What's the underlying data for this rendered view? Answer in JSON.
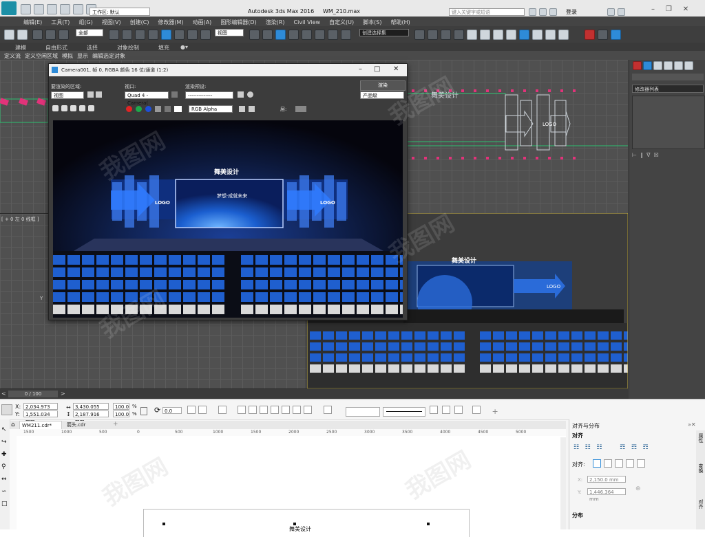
{
  "max": {
    "app_title": "Autodesk 3ds Max 2016",
    "file_name": "WM_210.max",
    "workspace_label": "工作区: 默认",
    "search_placeholder": "键入关键字或短语",
    "login_label": "登录",
    "menu": [
      "编辑(E)",
      "工具(T)",
      "组(G)",
      "视图(V)",
      "创建(C)",
      "修改器(M)",
      "动画(A)",
      "图形编辑器(D)",
      "渲染(R)",
      "Civil View",
      "自定义(U)",
      "脚本(S)",
      "帮助(H)"
    ],
    "toolbar_select_all": "全部",
    "toolbar_view": "视图",
    "toolbar_named_sel": "创建选择集",
    "ribbon_tabs": [
      "建模",
      "自由形式",
      "选择",
      "对象绘制",
      "填充"
    ],
    "ribbon_sub": [
      "定义流",
      "定义空闲区域",
      "模拟",
      "显示",
      "编辑选定对象"
    ],
    "viewport_label_left": "[ + 0 左 0 线框 ]",
    "viewport_left_axis": "Y",
    "timeline": "0 / 100",
    "top_view_title_text": "舞美设计",
    "top_view_logo": "LOGO",
    "render_window": {
      "title": "Camera001, 帧 0, RGBA 颜色 16 位/通道 (1:2)",
      "area_label": "要渲染的区域:",
      "area_value": "视图",
      "viewport_label": "视口:",
      "viewport_value": "Quad 4 - Camera(",
      "preset_label": "渲染预设:",
      "preset_value": "--------------",
      "render_button": "渲染",
      "product_value": "产品级",
      "channel_value": "RGB Alpha",
      "layer_label": "层:",
      "stage_title": "舞美设计",
      "screen_text": "梦想·成就未来",
      "logo": "LOGO"
    },
    "camera_view": {
      "stage_title": "舞美设计",
      "logo": "LOGO"
    },
    "right_panel": {
      "modifier_list": "修改器列表"
    },
    "colors": {
      "stage_blue": "#2a6bd9",
      "chair_blue": "#1f5fcf",
      "chair_white": "#d9d9d9",
      "selection_green": "#2dbf6f",
      "marker_pink": "#e1337a"
    }
  },
  "corel": {
    "x_label": "X:",
    "x_value": "2,034.973 mm",
    "y_label": "Y:",
    "y_value": "1,551.034 mm",
    "w_value": "3,430.055 mm",
    "h_value": "2,187.916 mm",
    "scale_w": "100.0",
    "scale_h": "100.0",
    "pct": "%",
    "rotation": "0.0",
    "tabs": [
      "WM211.cdr*",
      "箭头.cdr"
    ],
    "ruler": [
      "1500",
      "1000",
      "500",
      "0",
      "500",
      "1000",
      "1500",
      "2000",
      "2500",
      "3000",
      "3500",
      "4000",
      "4500",
      "5000"
    ],
    "docker_title": "对齐与分布",
    "align_header": "对齐",
    "align_to_label": "对齐:",
    "field_x": "2,150.0 mm",
    "field_y": "1,446.364 mm",
    "distribute_header": "分布",
    "side_tabs": [
      "属性",
      "变换",
      "对齐"
    ],
    "canvas_text": "舞美设计"
  }
}
